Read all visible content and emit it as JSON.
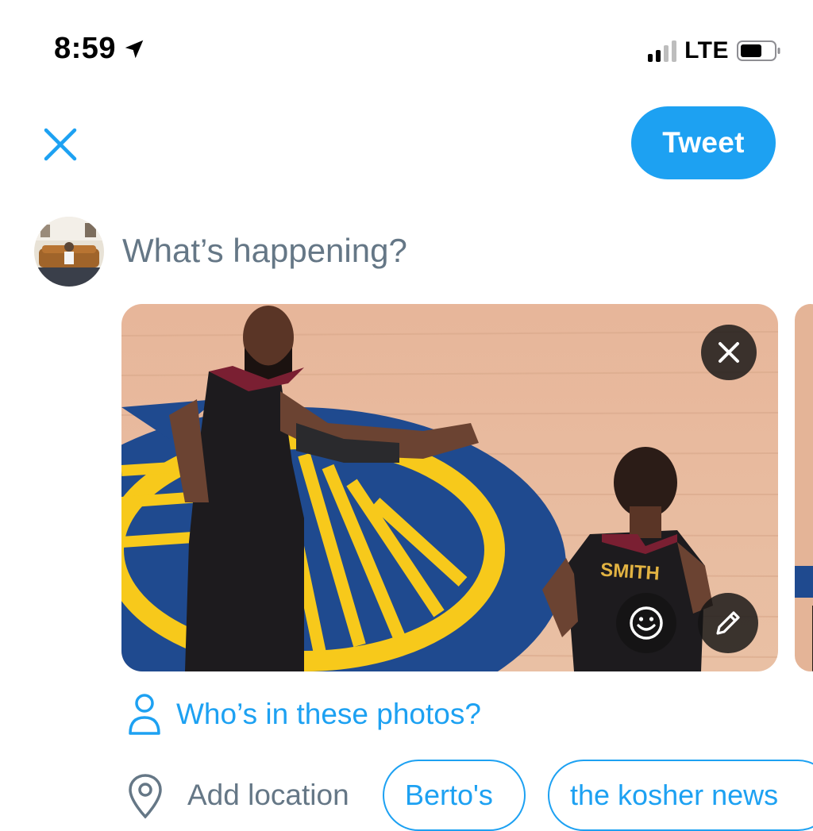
{
  "status_bar": {
    "time": "8:59",
    "network": "LTE",
    "location_icon": "location-arrow-icon",
    "signal_bars_active": 2,
    "signal_bars_total": 4
  },
  "top_bar": {
    "close_icon": "close-icon",
    "tweet_label": "Tweet"
  },
  "composer": {
    "placeholder": "What’s happening?",
    "avatar": "user-avatar"
  },
  "media": {
    "remove_icon": "close-icon",
    "sticker_icon": "smiley-icon",
    "edit_icon": "pencil-icon",
    "jersey_text": "SMITH"
  },
  "tag_people": {
    "icon": "person-icon",
    "label": "Who’s in these photos?"
  },
  "location": {
    "icon": "location-pin-icon",
    "label": "Add location",
    "suggestions": [
      "Berto's",
      "the kosher news"
    ]
  },
  "colors": {
    "accent": "#1da1f2",
    "placeholder": "#657786",
    "overlay_button": "#141414"
  }
}
